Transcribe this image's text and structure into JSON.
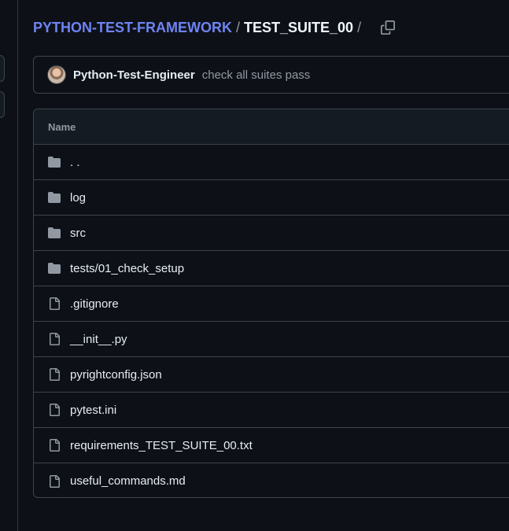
{
  "breadcrumb": {
    "repo": "PYTHON-TEST-FRAMEWORK",
    "separator": "/",
    "current": "TEST_SUITE_00",
    "trailing_separator": "/"
  },
  "commit": {
    "author": "Python-Test-Engineer",
    "message": "check all suites pass"
  },
  "table": {
    "header": "Name",
    "rows": [
      {
        "name": ". .",
        "type": "folder"
      },
      {
        "name": "log",
        "type": "folder"
      },
      {
        "name": "src",
        "type": "folder"
      },
      {
        "name": "tests/01_check_setup",
        "type": "folder"
      },
      {
        "name": ".gitignore",
        "type": "file"
      },
      {
        "name": "__init__.py",
        "type": "file"
      },
      {
        "name": "pyrightconfig.json",
        "type": "file"
      },
      {
        "name": "pytest.ini",
        "type": "file"
      },
      {
        "name": "requirements_TEST_SUITE_00.txt",
        "type": "file"
      },
      {
        "name": "useful_commands.md",
        "type": "file"
      }
    ]
  },
  "icons": {
    "folder": "file-directory-fill-icon",
    "file": "file-icon",
    "copy": "copy-icon"
  },
  "colors": {
    "background": "#0d1117",
    "border": "#3d444d",
    "link": "#6f83f2",
    "muted": "#9198a1",
    "text": "#e6edf3"
  }
}
